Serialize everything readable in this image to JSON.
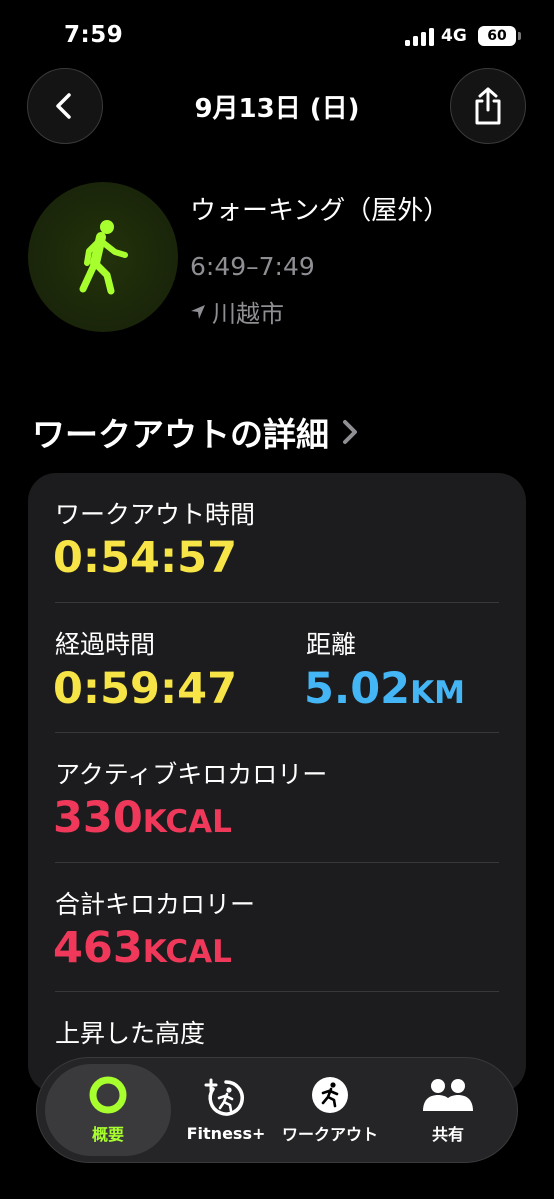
{
  "status_bar": {
    "time": "7:59",
    "network": "4G",
    "battery": "60"
  },
  "header": {
    "title": "9月13日 (日)",
    "back_icon": "chevron-left-icon",
    "share_icon": "share-icon"
  },
  "workout": {
    "name": "ウォーキング（屋外）",
    "time_range": "6:49–7:49",
    "location": "川越市",
    "icon": "walking-figure-icon",
    "accent_color": "#a8ff2e"
  },
  "section": {
    "title": "ワークアウトの詳細"
  },
  "metrics": {
    "workout_time": {
      "label": "ワークアウト時間",
      "value": "0:54:57"
    },
    "elapsed_time": {
      "label": "経過時間",
      "value": "0:59:47"
    },
    "distance": {
      "label": "距離",
      "value": "5.02",
      "unit": "KM"
    },
    "active_calories": {
      "label": "アクティブキロカロリー",
      "value": "330",
      "unit": "KCAL"
    },
    "total_calories": {
      "label": "合計キロカロリー",
      "value": "463",
      "unit": "KCAL"
    },
    "elevation_gain": {
      "label": "上昇した高度"
    }
  },
  "colors": {
    "time": "#f7e547",
    "distance": "#44b6f5",
    "calories": "#f0395a",
    "active_tab": "#a8ff2e"
  },
  "tabs": [
    {
      "label": "概要",
      "icon": "activity-ring-icon",
      "active": true
    },
    {
      "label": "Fitness+",
      "icon": "fitness-plus-icon",
      "active": false
    },
    {
      "label": "ワークアウト",
      "icon": "running-figure-icon",
      "active": false
    },
    {
      "label": "共有",
      "icon": "people-icon",
      "active": false
    }
  ]
}
